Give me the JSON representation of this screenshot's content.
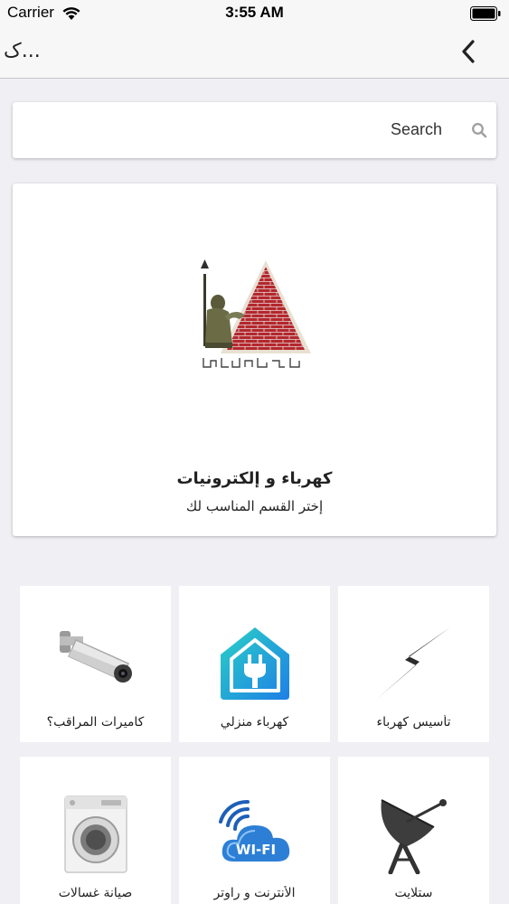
{
  "status_bar": {
    "carrier": "Carrier",
    "time": "3:55 AM"
  },
  "nav": {
    "title": "ک...",
    "back_icon": "chevron-left-icon"
  },
  "search": {
    "placeholder": "Search",
    "icon": "search-icon"
  },
  "header": {
    "title": "كهرباء و إلكترونيات",
    "subtitle": "إختر القسم المناسب لك"
  },
  "categories": [
    {
      "label": "كاميرات المراقب؟",
      "icon": "security-camera-icon"
    },
    {
      "label": "كهرباء منزلي",
      "icon": "home-plug-icon"
    },
    {
      "label": "تأسيس كهرباء",
      "icon": "lightning-bolt-icon"
    },
    {
      "label": "صيانة غسالات",
      "icon": "washing-machine-icon"
    },
    {
      "label": "الأنترنت و راوتر",
      "icon": "wifi-cloud-icon"
    },
    {
      "label": "ستلايت",
      "icon": "satellite-dish-icon"
    }
  ],
  "colors": {
    "background": "#efeff4",
    "bar": "#f7f7f7",
    "card": "#ffffff"
  }
}
